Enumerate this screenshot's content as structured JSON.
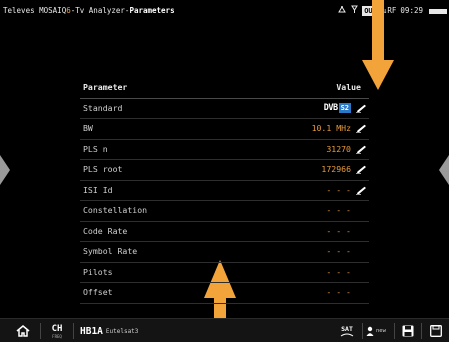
{
  "topbar": {
    "brand": "Televes MOSAIQ",
    "brand_mark": "6",
    "app": "Tv Analyzer",
    "separator": "-",
    "page": "Parameters",
    "out_badge": "OUT",
    "rf_label": "↓RF",
    "time": "09:29"
  },
  "table": {
    "header_name": "Parameter",
    "header_value": "Value",
    "rows": [
      {
        "name": "Standard",
        "value": "DVB S2",
        "editable": true
      },
      {
        "name": "BW",
        "value": "10.1 MHz",
        "editable": true
      },
      {
        "name": "PLS n",
        "value": "31270",
        "editable": true
      },
      {
        "name": "PLS root",
        "value": "172966",
        "editable": true
      },
      {
        "name": "ISI Id",
        "value": "- - -",
        "editable": true
      },
      {
        "name": "Constellation",
        "value": "- - -",
        "editable": false
      },
      {
        "name": "Code Rate",
        "value": "- - -",
        "editable": false
      },
      {
        "name": "Symbol Rate",
        "value": "- - -",
        "editable": false
      },
      {
        "name": "Pilots",
        "value": "- - -",
        "editable": false
      },
      {
        "name": "Offset",
        "value": "- - -",
        "editable": false
      }
    ],
    "standard_logo": {
      "dvb": "DVB",
      "s2": "S2"
    }
  },
  "bottombar": {
    "ch_label": "CH",
    "ch_sub": "FREQ",
    "channel": "HB1A",
    "satellite": "Eutelsat3",
    "sat_label": "SAT",
    "new_label": "new"
  },
  "colors": {
    "accent": "#f2a33a",
    "value": "#e89a3a",
    "dvb_s2": "#2a78c8"
  }
}
